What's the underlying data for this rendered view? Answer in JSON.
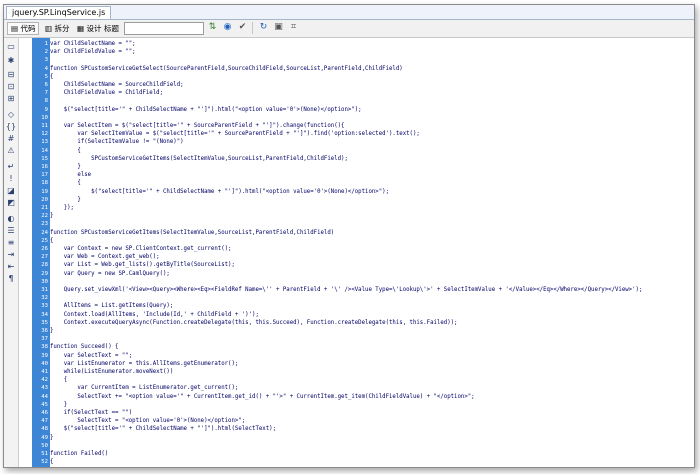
{
  "tab": {
    "label": "jquery.SP.LinqService.js"
  },
  "toolbar": {
    "code_label": "代码",
    "split_label": "拆分",
    "design_label": "设计",
    "title_label": "标题"
  },
  "icons": {
    "code": "code-view-icon",
    "split": "split-view-icon",
    "design": "design-view-icon",
    "file_mgmt": "file-management-icon",
    "preview": "preview-icon",
    "refresh": "refresh-icon",
    "options": "view-options-icon"
  },
  "sidebar_icons": [
    "open-documents-icon",
    "show-code-navigator-icon",
    "collapse-full-tag-icon",
    "collapse-selection-icon",
    "expand-all-icon",
    "select-parent-tag-icon",
    "balance-braces-icon",
    "line-numbers-icon",
    "highlight-invalid-code-icon",
    "word-wrap-icon",
    "syntax-error-alerts-icon",
    "apply-comment-icon",
    "remove-comment-icon",
    "wrap-tag-icon",
    "recent-snippets-icon",
    "move-css-icon",
    "indent-code-icon",
    "outdent-code-icon",
    "format-source-icon"
  ],
  "code_lines": [
    {
      "n": "1",
      "t": "var ChildSelectName = \"\";"
    },
    {
      "n": "2",
      "t": "var ChildFieldValue = \"\";"
    },
    {
      "n": "3",
      "t": ""
    },
    {
      "n": "4",
      "t": "function SPCustomServiceGetSelect(SourceParentField,SourceChildField,SourceList,ParentField,ChildField)"
    },
    {
      "n": "5",
      "t": "{"
    },
    {
      "n": "6",
      "t": "    ChildSelectName = SourceChildField;"
    },
    {
      "n": "7",
      "t": "    ChildFieldValue = ChildField;"
    },
    {
      "n": "8",
      "t": ""
    },
    {
      "n": "9",
      "t": "    $(\"select[title='\" + ChildSelectName + \"']\").html(\"<option value='0'>(None)</option>\");"
    },
    {
      "n": "10",
      "t": ""
    },
    {
      "n": "11",
      "t": "    var SelectItem = $(\"select[title='\" + SourceParentField + \"']\").change(function(){"
    },
    {
      "n": "12",
      "t": "        var SelectItemValue = $(\"select[title='\" + SourceParentField + \"']\").find('option:selected').text();"
    },
    {
      "n": "13",
      "t": "        if(SelectItemValue != \"(None)\")"
    },
    {
      "n": "14",
      "t": "        {"
    },
    {
      "n": "15",
      "t": "            SPCustomServiceGetItems(SelectItemValue,SourceList,ParentField,ChildField);"
    },
    {
      "n": "16",
      "t": "        }"
    },
    {
      "n": "17",
      "t": "        else"
    },
    {
      "n": "18",
      "t": "        {"
    },
    {
      "n": "19",
      "t": "            $(\"select[title='\" + ChildSelectName + \"']\").html(\"<option value='0'>(None)</option>\");"
    },
    {
      "n": "20",
      "t": "        }"
    },
    {
      "n": "21",
      "t": "    });"
    },
    {
      "n": "22",
      "t": "}"
    },
    {
      "n": "23",
      "t": ""
    },
    {
      "n": "24",
      "t": "function SPCustomServiceGetItems(SelectItemValue,SourceList,ParentField,ChildField)"
    },
    {
      "n": "25",
      "t": "{"
    },
    {
      "n": "26",
      "t": "    var Context = new SP.ClientContext.get_current();"
    },
    {
      "n": "27",
      "t": "    var Web = Context.get_web();"
    },
    {
      "n": "28",
      "t": "    var List = Web.get_lists().getByTitle(SourceList);"
    },
    {
      "n": "29",
      "t": "    var Query = new SP.CamlQuery();"
    },
    {
      "n": "30",
      "t": ""
    },
    {
      "n": "31",
      "t": "    Query.set_viewXml('<View><Query><Where><Eq><FieldRef Name=\\'' + ParentField + '\\' /><Value Type=\\'Lookup\\'>' + SelectItemValue + '</Value></Eq></Where></Query></View>');"
    },
    {
      "n": "32",
      "t": ""
    },
    {
      "n": "33",
      "t": "    AllItems = List.getItems(Query);"
    },
    {
      "n": "34",
      "t": "    Context.load(AllItems, 'Include(Id,' + ChildField + ')');"
    },
    {
      "n": "35",
      "t": "    Context.executeQueryAsync(Function.createDelegate(this, this.Succeed), Function.createDelegate(this, this.Failed));"
    },
    {
      "n": "36",
      "t": "}"
    },
    {
      "n": "37",
      "t": ""
    },
    {
      "n": "38",
      "t": "function Succeed() {"
    },
    {
      "n": "39",
      "t": "    var SelectText = \"\";"
    },
    {
      "n": "40",
      "t": "    var ListEnumerator = this.AllItems.getEnumerator();"
    },
    {
      "n": "41",
      "t": "    while(ListEnumerator.moveNext())"
    },
    {
      "n": "42",
      "t": "    {"
    },
    {
      "n": "43",
      "t": "        var CurrentItem = ListEnumerator.get_current();"
    },
    {
      "n": "44",
      "t": "        SelectText += \"<option value='\" + CurrentItem.get_id() + \"'>\" + CurrentItem.get_item(ChildFieldValue) + \"</option>\";"
    },
    {
      "n": "45",
      "t": "    }"
    },
    {
      "n": "46",
      "t": "    if(SelectText == \"\")"
    },
    {
      "n": "47",
      "t": "        SelectText = \"<option value='0'>(None)</option>\";"
    },
    {
      "n": "48",
      "t": "    $(\"select[title='\" + ChildSelectName + \"']\").html(SelectText);"
    },
    {
      "n": "49",
      "t": "}"
    },
    {
      "n": "50",
      "t": ""
    },
    {
      "n": "51",
      "t": "function Failed()"
    },
    {
      "n": "52",
      "t": "{"
    },
    {
      "n": "53",
      "t": "}"
    }
  ]
}
